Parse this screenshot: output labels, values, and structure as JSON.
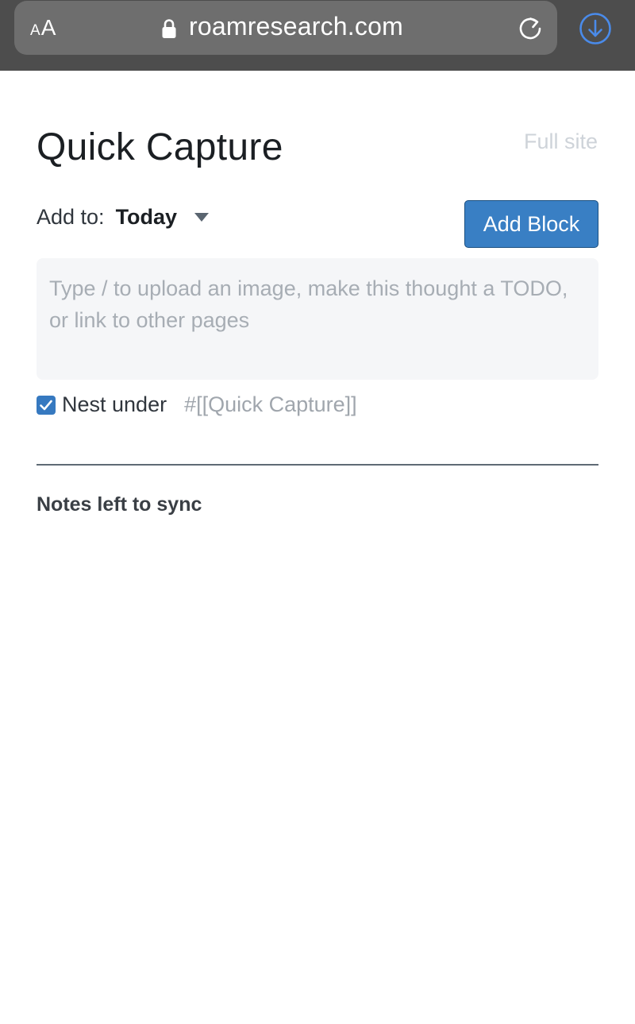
{
  "browser": {
    "text_size_small": "A",
    "text_size_large": "A",
    "url": "roamresearch.com",
    "icons": {
      "lock": "lock-icon",
      "reload": "reload-icon",
      "download": "download-icon"
    },
    "colors": {
      "bar": "#4d4d4d",
      "pill": "#6e6e6e",
      "download_accent": "#4a8bea"
    }
  },
  "page": {
    "title": "Quick Capture",
    "full_site_label": "Full site"
  },
  "add_to": {
    "label": "Add to:",
    "selected": "Today",
    "icon": "caret-down-icon"
  },
  "actions": {
    "add_block_label": "Add Block",
    "accent_color": "#397fc4"
  },
  "editor": {
    "value": "",
    "placeholder": "Type / to upload an image, make this thought a TODO, or link to other pages"
  },
  "nest": {
    "checked": true,
    "label": "Nest under",
    "tag": "#[[Quick Capture]]"
  },
  "sync": {
    "heading": "Notes left to sync"
  }
}
